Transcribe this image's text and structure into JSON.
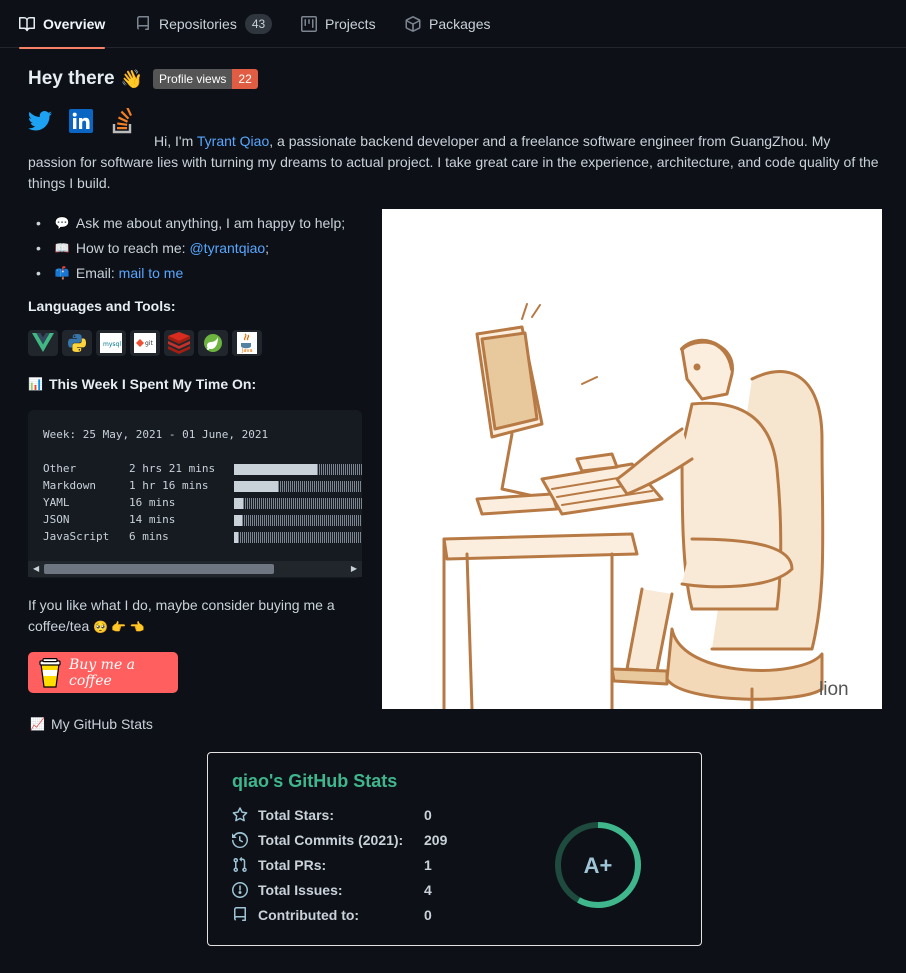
{
  "tabs": [
    {
      "label": "Overview",
      "icon": "book-icon",
      "active": true
    },
    {
      "label": "Repositories",
      "icon": "repo-icon",
      "count": "43"
    },
    {
      "label": "Projects",
      "icon": "project-icon"
    },
    {
      "label": "Packages",
      "icon": "package-icon"
    }
  ],
  "readme": {
    "heading": "Hey there",
    "wave_emoji": "👋",
    "views_badge": {
      "label": "Profile views",
      "value": "22",
      "color": "#e05d44"
    },
    "social_icons": [
      "twitter-icon",
      "linkedin-icon",
      "stackoverflow-icon"
    ],
    "intro_pre": "Hi, I'm ",
    "intro_link": "Tyrant Qiao",
    "intro_post": ", a passionate backend developer and a freelance software engineer from GuangZhou. My passion for software lies with turning my dreams to actual project. I take great care in the experience, architecture, and code quality of the things I build.",
    "bullets": [
      {
        "emoji": "💬",
        "text": "Ask me about anything, I am happy to help;"
      },
      {
        "emoji": "📖",
        "text": "How to reach me: ",
        "link": "@tyrantqiao",
        "suffix": ";"
      },
      {
        "emoji": "📫",
        "text": "Email: ",
        "link": "mail to me",
        "suffix": ""
      }
    ],
    "languages_heading": "Languages and Tools:",
    "tools": [
      "vue-icon",
      "python-icon",
      "mysql-icon",
      "git-icon",
      "redis-icon",
      "spring-icon",
      "java-icon"
    ],
    "week_heading_emoji": "📊",
    "week_heading": "This Week I Spent My Time On:",
    "wakatime": {
      "range": "Week: 25 May, 2021 - 01 June, 2021",
      "rows": [
        {
          "name": "Other",
          "time": "2 hrs 21 mins",
          "fraction": 0.64
        },
        {
          "name": "Markdown",
          "time": "1 hr 16 mins",
          "fraction": 0.34
        },
        {
          "name": "YAML",
          "time": "16 mins",
          "fraction": 0.07
        },
        {
          "name": "JSON",
          "time": "14 mins",
          "fraction": 0.06
        },
        {
          "name": "JavaScript",
          "time": "6 mins",
          "fraction": 0.03
        }
      ]
    },
    "coffee_text": "If you like what I do, maybe consider buying me a coffee/tea",
    "coffee_emoji": "🥺 👉 👈",
    "bmc_label": "Buy me a coffee",
    "stats_heading_emoji": "📈",
    "stats_heading": "My GitHub Stats",
    "art_signature": "lion"
  },
  "stats_card": {
    "title": "qiao's GitHub Stats",
    "rows": [
      {
        "icon": "star-icon",
        "label": "Total Stars:",
        "value": "0"
      },
      {
        "icon": "history-icon",
        "label": "Total Commits (2021):",
        "value": "209"
      },
      {
        "icon": "pull-request-icon",
        "label": "Total PRs:",
        "value": "1"
      },
      {
        "icon": "issue-icon",
        "label": "Total Issues:",
        "value": "4"
      },
      {
        "icon": "repo-icon",
        "label": "Contributed to:",
        "value": "0"
      }
    ],
    "grade": "A+",
    "grade_progress": 0.58,
    "accent": "#3fb68b"
  }
}
